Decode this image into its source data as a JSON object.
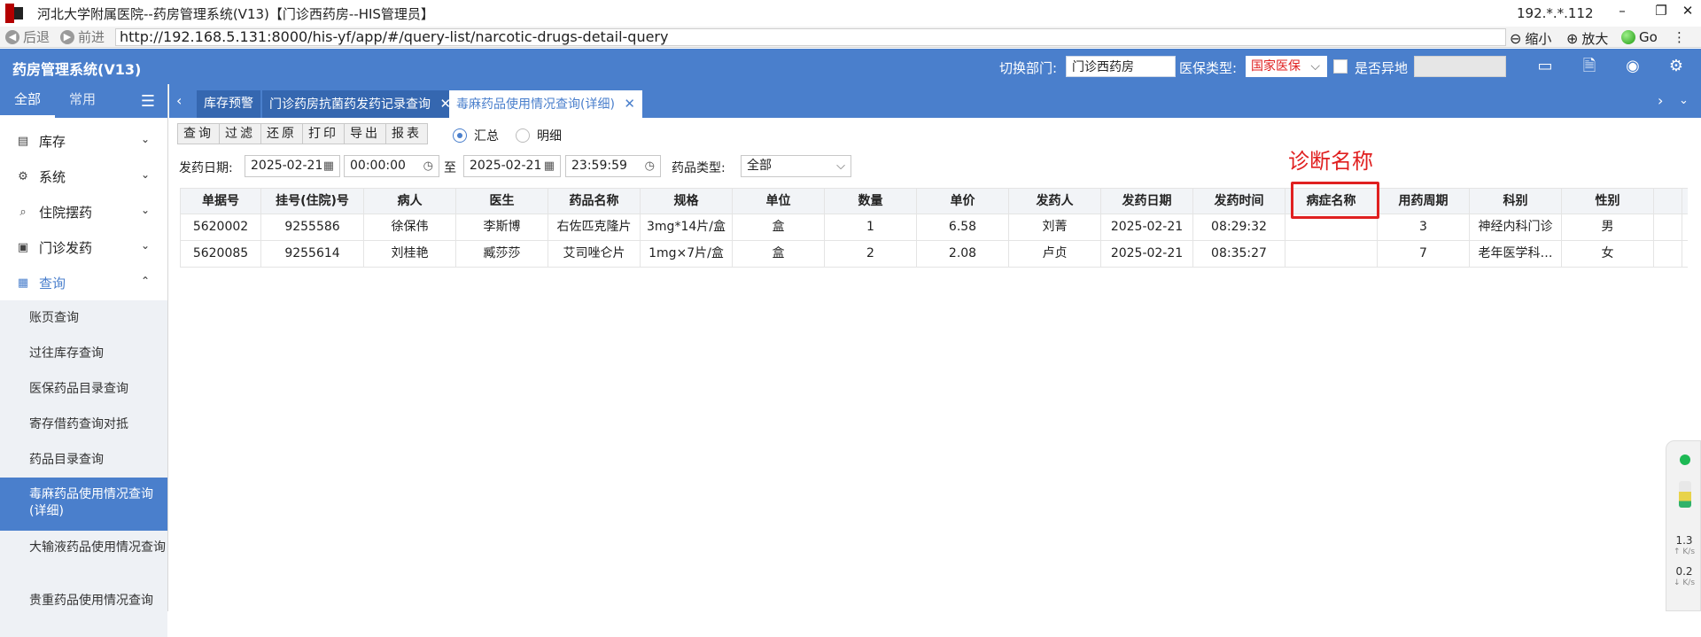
{
  "window": {
    "title": "河北大学附属医院--药房管理系统(V13)【门诊西药房--HIS管理员】",
    "ip": "192.*.*.112",
    "minimize": "–",
    "restore": "❐",
    "close": "✕"
  },
  "browser": {
    "back": "后退",
    "forward": "前进",
    "url": "http://192.168.5.131:8000/his-yf/app/#/query-list/narcotic-drugs-detail-query",
    "zoom_out": "缩小",
    "zoom_in": "放大",
    "go": "Go",
    "more": "⋮"
  },
  "header": {
    "app_name": "药房管理系统(V13)",
    "dept_label": "切换部门:",
    "dept_value": "门诊西药房",
    "insurance_label": "医保类型:",
    "insurance_value": "国家医保",
    "remote_label": "是否异地"
  },
  "sidebar": {
    "tab_all": "全部",
    "tab_common": "常用",
    "groups": [
      {
        "label": "库存"
      },
      {
        "label": "系统"
      },
      {
        "label": "住院摆药"
      },
      {
        "label": "门诊发药"
      },
      {
        "label": "查询"
      }
    ],
    "sub_items": [
      {
        "label": "账页查询"
      },
      {
        "label": "过往库存查询"
      },
      {
        "label": "医保药品目录查询"
      },
      {
        "label": "寄存借药查询对抵"
      },
      {
        "label": "药品目录查询"
      },
      {
        "label": "毒麻药品使用情况查询(详细)"
      },
      {
        "label": "大输液药品使用情况查询"
      },
      {
        "label": "贵重药品使用情况查询"
      }
    ]
  },
  "tabs": [
    {
      "label": "库存预警"
    },
    {
      "label": "门诊药房抗菌药发药记录查询"
    },
    {
      "label": "毒麻药品使用情况查询(详细)"
    }
  ],
  "toolbar": {
    "query": "查询",
    "filter": "过滤",
    "reset": "还原",
    "print": "打印",
    "export": "导出",
    "report": "报表",
    "summary": "汇总",
    "detail": "明细"
  },
  "filter": {
    "date_label": "发药日期:",
    "start_date": "2025-02-21",
    "start_time": "00:00:00",
    "to": "至",
    "end_date": "2025-02-21",
    "end_time": "23:59:59",
    "type_label": "药品类型:",
    "type_value": "全部"
  },
  "annotation": "诊断名称",
  "table": {
    "columns": [
      "单据号",
      "挂号(住院)号",
      "病人",
      "医生",
      "药品名称",
      "规格",
      "单位",
      "数量",
      "单价",
      "发药人",
      "发药日期",
      "发药时间",
      "病症名称",
      "用药周期",
      "科别",
      "性别",
      ""
    ],
    "rows": [
      [
        "5620002",
        "9255586",
        "徐保伟",
        "李斯博",
        "右佐匹克隆片",
        "3mg*14片/盒",
        "盒",
        "1",
        "6.58",
        "刘菁",
        "2025-02-21",
        "08:29:32",
        "",
        "3",
        "神经内科门诊",
        "男",
        ""
      ],
      [
        "5620085",
        "9255614",
        "刘桂艳",
        "臧莎莎",
        "艾司唑仑片",
        "1mg×7片/盒",
        "盒",
        "2",
        "2.08",
        "卢贞",
        "2025-02-21",
        "08:35:27",
        "",
        "7",
        "老年医学科…",
        "女",
        ""
      ]
    ]
  },
  "widget": {
    "up_value": "1.3",
    "up_unit": "↑ K/s",
    "down_value": "0.2",
    "down_unit": "↓ K/s"
  }
}
